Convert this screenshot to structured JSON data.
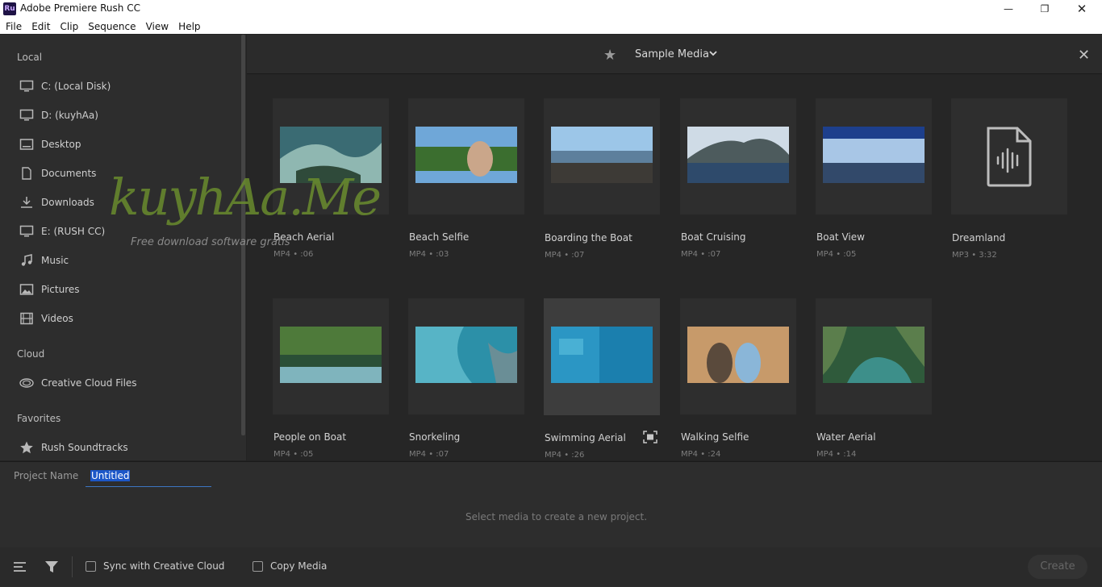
{
  "window": {
    "title": "Adobe Premiere Rush CC",
    "icon_text": "Ru"
  },
  "menu": [
    "File",
    "Edit",
    "Clip",
    "Sequence",
    "View",
    "Help"
  ],
  "sidebar": {
    "local_label": "Local",
    "local_items": [
      {
        "label": "C: (Local Disk)",
        "icon": "monitor-icon"
      },
      {
        "label": "D: (kuyhAa)",
        "icon": "monitor-icon"
      },
      {
        "label": "Desktop",
        "icon": "desktop-icon"
      },
      {
        "label": "Documents",
        "icon": "document-icon"
      },
      {
        "label": "Downloads",
        "icon": "download-icon"
      },
      {
        "label": "E: (RUSH CC)",
        "icon": "monitor-icon"
      },
      {
        "label": "Music",
        "icon": "music-icon"
      },
      {
        "label": "Pictures",
        "icon": "picture-icon"
      },
      {
        "label": "Videos",
        "icon": "film-icon"
      }
    ],
    "cloud_label": "Cloud",
    "cloud_items": [
      {
        "label": "Creative Cloud Files",
        "icon": "creative-cloud-icon"
      }
    ],
    "favorites_label": "Favorites",
    "favorite_items": [
      {
        "label": "Rush Soundtracks",
        "icon": "star-icon"
      }
    ]
  },
  "header": {
    "title": "Sample Media"
  },
  "media": [
    {
      "name": "Beach Aerial",
      "meta": "MP4 • :06",
      "colors": [
        "#3a6b73",
        "#8fb7b1",
        "#2f4a3a"
      ]
    },
    {
      "name": "Beach Selfie",
      "meta": "MP4 • :03",
      "colors": [
        "#6fa7d8",
        "#3b6e2f",
        "#caa68a"
      ]
    },
    {
      "name": "Boarding the Boat",
      "meta": "MP4 • :07",
      "colors": [
        "#9cc6e8",
        "#5d7f9c",
        "#3d3a36"
      ]
    },
    {
      "name": "Boat Cruising",
      "meta": "MP4 • :07",
      "colors": [
        "#cfdbe6",
        "#4d5b5d",
        "#2e4a6b"
      ]
    },
    {
      "name": "Boat View",
      "meta": "MP4 • :05",
      "colors": [
        "#1d3f8c",
        "#a8c6e6",
        "#32496a"
      ]
    },
    {
      "name": "Dreamland",
      "meta": "MP3 • 3:32",
      "colors": []
    },
    {
      "name": "People on Boat",
      "meta": "MP4 • :05",
      "colors": [
        "#4e7a3a",
        "#2a4f36",
        "#7fb4bd"
      ]
    },
    {
      "name": "Snorkeling",
      "meta": "MP4 • :07",
      "colors": [
        "#2c90a8",
        "#57b4c6",
        "#6a8e96"
      ]
    },
    {
      "name": "Swimming Aerial",
      "meta": "MP4 • :26",
      "colors": [
        "#1b7fae",
        "#2b96c4",
        "#49b0d4"
      ]
    },
    {
      "name": "Walking Selfie",
      "meta": "MP4 • :24",
      "colors": [
        "#c79a6a",
        "#5a4a3c",
        "#8ab6d8"
      ]
    },
    {
      "name": "Water Aerial",
      "meta": "MP4 • :14",
      "colors": [
        "#2f5a3b",
        "#3d8f8a",
        "#5b7e4c"
      ]
    }
  ],
  "watermark": {
    "text": "kuyhAa.Me",
    "sub": "Free download software gratis"
  },
  "project": {
    "label": "Project Name",
    "value": "Untitled"
  },
  "hint": "Select media to create a new project.",
  "bottom": {
    "sync_label": "Sync with Creative Cloud",
    "copy_label": "Copy Media",
    "create_label": "Create"
  }
}
